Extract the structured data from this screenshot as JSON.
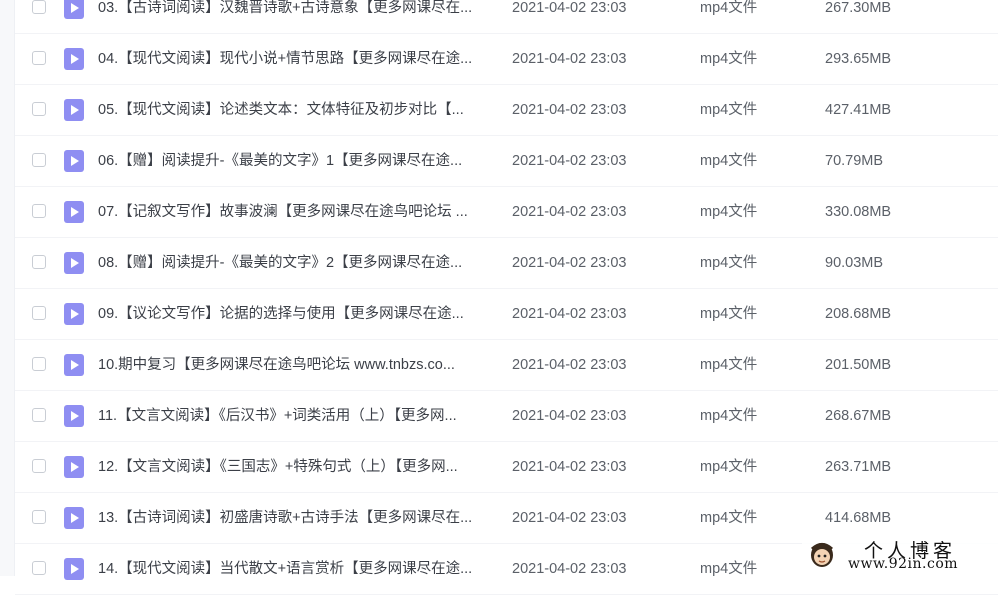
{
  "colors": {
    "file_icon": "#8f8ef2",
    "text": "#3b3f47",
    "muted": "#5b6068"
  },
  "files": [
    {
      "name": "03.【古诗词阅读】汉魏晋诗歌+古诗意象【更多网课尽在...",
      "date": "2021-04-02 23:03",
      "type": "mp4文件",
      "size": "267.30MB"
    },
    {
      "name": "04.【现代文阅读】现代小说+情节思路【更多网课尽在途...",
      "date": "2021-04-02 23:03",
      "type": "mp4文件",
      "size": "293.65MB"
    },
    {
      "name": "05.【现代文阅读】论述类文本：文体特征及初步对比【...",
      "date": "2021-04-02 23:03",
      "type": "mp4文件",
      "size": "427.41MB"
    },
    {
      "name": "06.【赠】阅读提升-《最美的文字》1【更多网课尽在途...",
      "date": "2021-04-02 23:03",
      "type": "mp4文件",
      "size": "70.79MB"
    },
    {
      "name": "07.【记叙文写作】故事波澜【更多网课尽在途鸟吧论坛 ...",
      "date": "2021-04-02 23:03",
      "type": "mp4文件",
      "size": "330.08MB"
    },
    {
      "name": "08.【赠】阅读提升-《最美的文字》2【更多网课尽在途...",
      "date": "2021-04-02 23:03",
      "type": "mp4文件",
      "size": "90.03MB"
    },
    {
      "name": "09.【议论文写作】论据的选择与使用【更多网课尽在途...",
      "date": "2021-04-02 23:03",
      "type": "mp4文件",
      "size": "208.68MB"
    },
    {
      "name": "10.期中复习【更多网课尽在途鸟吧论坛 www.tnbzs.co...",
      "date": "2021-04-02 23:03",
      "type": "mp4文件",
      "size": "201.50MB"
    },
    {
      "name": "11.【文言文阅读】《后汉书》+词类活用（上）【更多网...",
      "date": "2021-04-02 23:03",
      "type": "mp4文件",
      "size": "268.67MB"
    },
    {
      "name": "12.【文言文阅读】《三国志》+特殊句式（上）【更多网...",
      "date": "2021-04-02 23:03",
      "type": "mp4文件",
      "size": "263.71MB"
    },
    {
      "name": "13.【古诗词阅读】初盛唐诗歌+古诗手法【更多网课尽在...",
      "date": "2021-04-02 23:03",
      "type": "mp4文件",
      "size": "414.68MB"
    },
    {
      "name": "14.【现代文阅读】当代散文+语言赏析【更多网课尽在途...",
      "date": "2021-04-02 23:03",
      "type": "mp4文件",
      "size": ""
    }
  ],
  "watermark": {
    "title": "个人博客",
    "url": "www.92in.com"
  }
}
